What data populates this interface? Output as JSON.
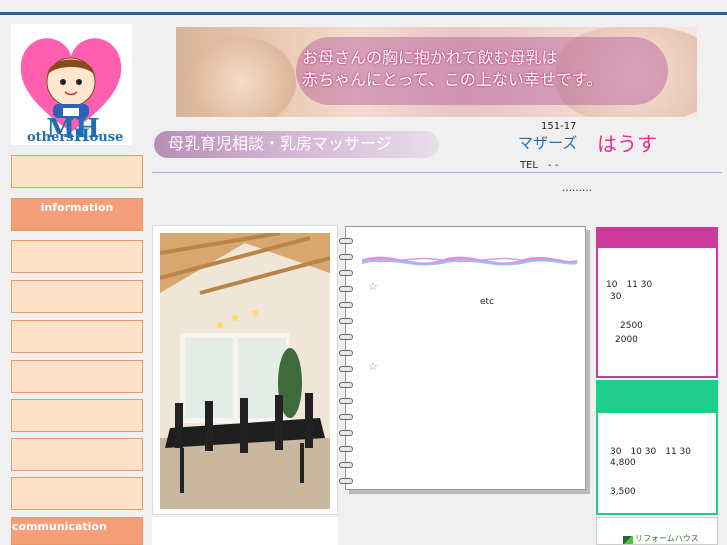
{
  "logo": {
    "text_big": "MH",
    "text_rest_1": "others",
    "text_rest_2": "ouse",
    "icon": "heart-baby-icon",
    "heart_color": "#ff5fae"
  },
  "banner": {
    "line1": "お母さんの胸に抱かれて飲む母乳は",
    "line2": "赤ちゃんにとって、この上ない幸せです。"
  },
  "subtitle": "母乳育児相談・乳房マッサージ",
  "header_info": {
    "zip": "151-17",
    "brand_katakana": "マザーズ",
    "brand_hiragana": "はうす",
    "tel": "TEL　- -"
  },
  "dots": "………",
  "sidebar": {
    "items": [
      {
        "label": ""
      },
      {
        "label": "information"
      },
      {
        "label": ""
      },
      {
        "label": ""
      },
      {
        "label": ""
      },
      {
        "label": ""
      },
      {
        "label": ""
      },
      {
        "label": ""
      },
      {
        "label": ""
      },
      {
        "label": "communication"
      }
    ]
  },
  "notebook": {
    "star": "☆",
    "etc": "etc"
  },
  "panel_pink": {
    "lines": [
      "10　11 30",
      "30",
      "2500",
      "2000"
    ]
  },
  "panel_green": {
    "lines": [
      "30　10 30　11 30",
      "4,800",
      "3,500"
    ]
  },
  "reform": {
    "label": "リフォームハウス",
    "icon": "reform-house-icon"
  },
  "colors": {
    "accent_blue": "#2f5f9a",
    "sidebar_bg": "#ffe3c8",
    "sidebar_active": "#f59e7a",
    "panel_pink": "#cc3a9c",
    "panel_green": "#1fcd8f",
    "brand_pink": "#e5308f"
  }
}
